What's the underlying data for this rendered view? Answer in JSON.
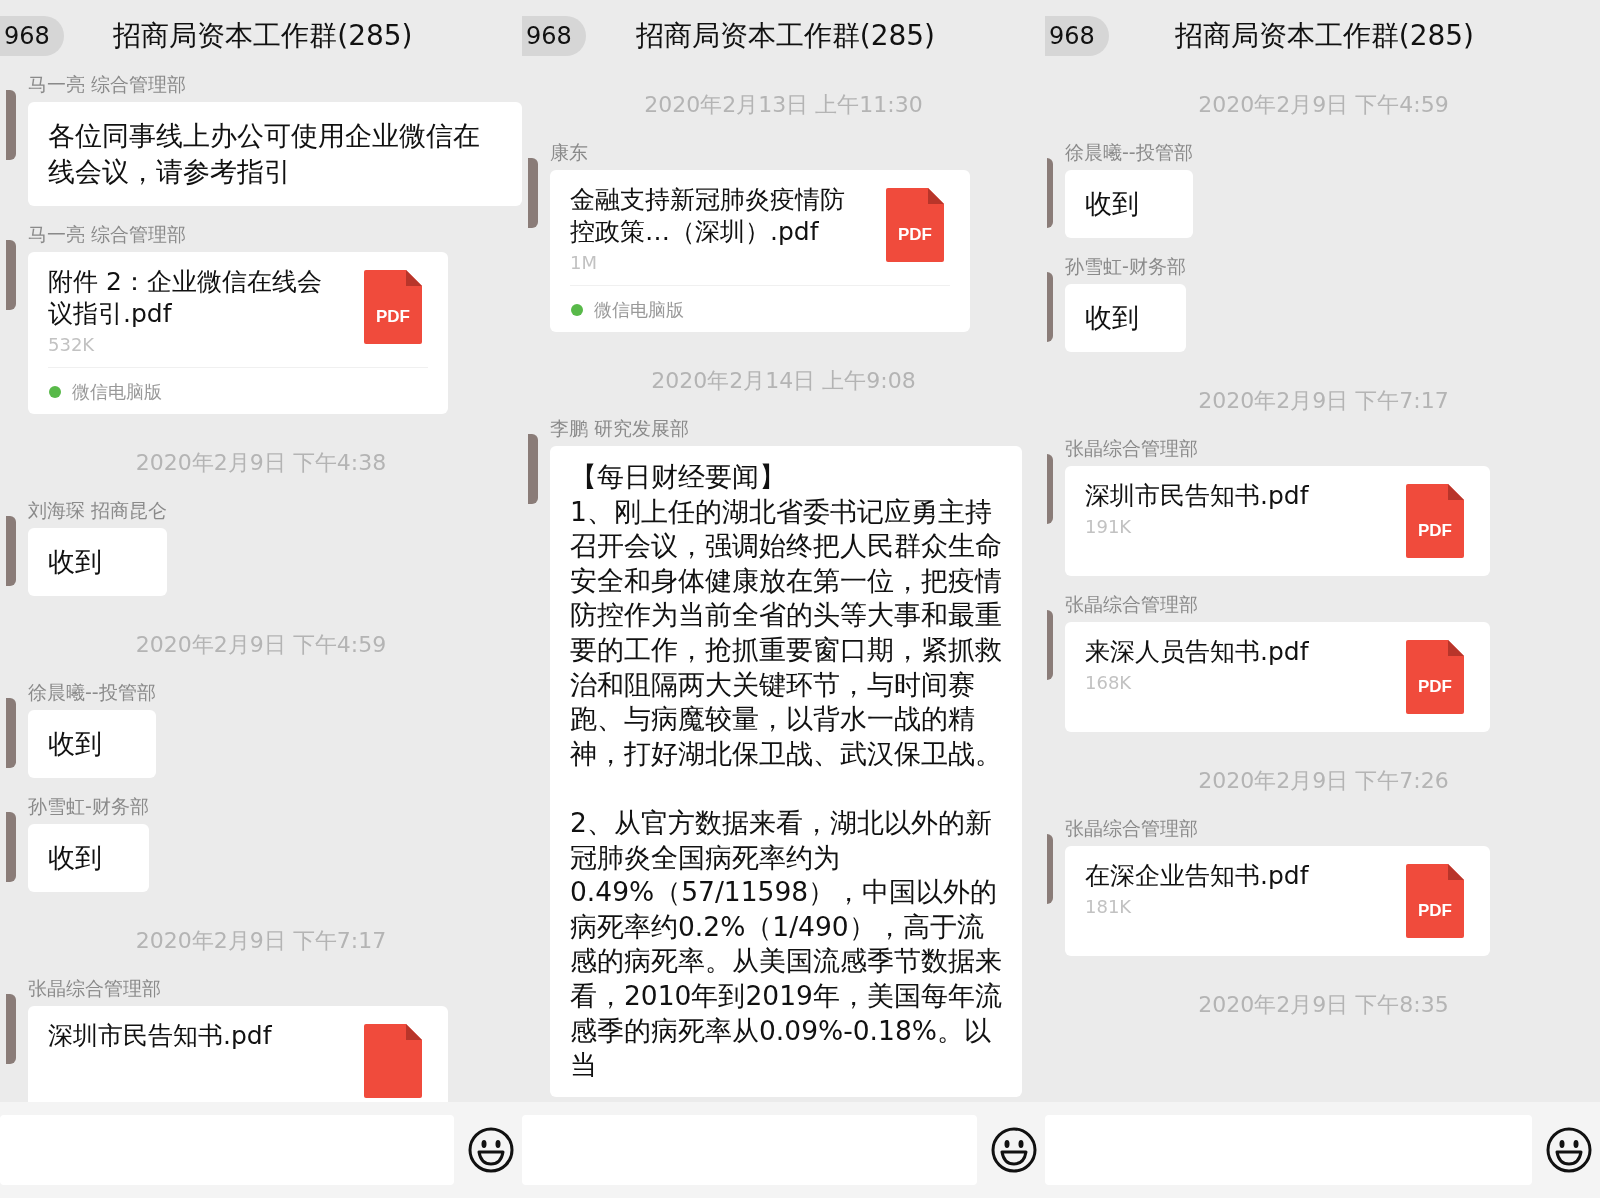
{
  "panels": [
    {
      "header": {
        "badge": "968",
        "title": "招商局资本工作群(285)"
      },
      "messages": [
        {
          "kind": "text",
          "sender": "马一亮 综合管理部",
          "text": "各位同事线上办公可使用企业微信在线会议，请参考指引"
        },
        {
          "kind": "file",
          "sender": "马一亮 综合管理部",
          "file_name": "附件 2：企业微信在线会议指引.pdf",
          "size": "532K",
          "icon_label": "PDF",
          "source": "微信电脑版"
        },
        {
          "kind": "time",
          "text": "2020年2月9日 下午4:38"
        },
        {
          "kind": "text",
          "sender": "刘海琛  招商昆仑",
          "text": "收到"
        },
        {
          "kind": "time",
          "text": "2020年2月9日 下午4:59"
        },
        {
          "kind": "text",
          "sender": "徐晨曦--投管部",
          "text": "收到"
        },
        {
          "kind": "text",
          "sender": "孙雪虹-财务部",
          "text": "收到"
        },
        {
          "kind": "time",
          "text": "2020年2月9日 下午7:17"
        },
        {
          "kind": "file",
          "sender": "张晶综合管理部",
          "file_name": "深圳市民告知书.pdf"
        }
      ]
    },
    {
      "header": {
        "badge": "968",
        "title": "招商局资本工作群(285)"
      },
      "messages": [
        {
          "kind": "time",
          "text": "2020年2月13日 上午11:30"
        },
        {
          "kind": "file",
          "sender": "康东",
          "file_name": "金融支持新冠肺炎疫情防控政策…（深圳）.pdf",
          "size": "1M",
          "icon_label": "PDF",
          "source": "微信电脑版"
        },
        {
          "kind": "time",
          "text": "2020年2月14日 上午9:08"
        },
        {
          "kind": "text",
          "sender": "李鹏 研究发展部",
          "text": "【每日财经要闻】\n1、刚上任的湖北省委书记应勇主持召开会议，强调始终把人民群众生命安全和身体健康放在第一位，把疫情防控作为当前全省的头等大事和最重要的工作，抢抓重要窗口期，紧抓救治和阻隔两大关键环节，与时间赛跑、与病魔较量，以背水一战的精神，打好湖北保卫战、武汉保卫战。\n\n2、从官方数据来看，湖北以外的新冠肺炎全国病死率约为0.49%（57/11598），中国以外的病死率约0.2%（1/490），高于流感的病死率。从美国流感季节数据来看，2010年到2019年，美国每年流感季的病死率从0.09%-0.18%。以当"
        }
      ]
    },
    {
      "header": {
        "badge": "968",
        "title": "招商局资本工作群(285)"
      },
      "messages": [
        {
          "kind": "time",
          "text": "2020年2月9日 下午4:59"
        },
        {
          "kind": "text",
          "sender": "徐晨曦--投管部",
          "text": "收到"
        },
        {
          "kind": "text",
          "sender": "孙雪虹-财务部",
          "text": "收到"
        },
        {
          "kind": "time",
          "text": "2020年2月9日 下午7:17"
        },
        {
          "kind": "file",
          "sender": "张晶综合管理部",
          "file_name": "深圳市民告知书.pdf",
          "size": "191K",
          "icon_label": "PDF"
        },
        {
          "kind": "file",
          "sender": "张晶综合管理部",
          "file_name": "来深人员告知书.pdf",
          "size": "168K",
          "icon_label": "PDF"
        },
        {
          "kind": "time",
          "text": "2020年2月9日 下午7:26"
        },
        {
          "kind": "file",
          "sender": "张晶综合管理部",
          "file_name": "在深企业告知书.pdf",
          "size": "181K",
          "icon_label": "PDF"
        },
        {
          "kind": "time",
          "text": "2020年2月9日 下午8:35"
        }
      ]
    }
  ]
}
